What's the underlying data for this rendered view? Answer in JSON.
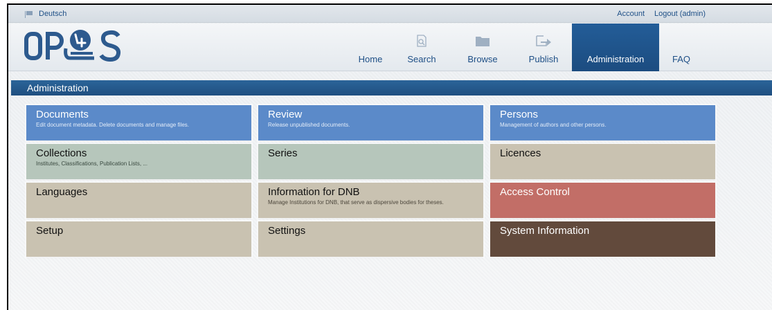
{
  "topbar": {
    "language_label": "Deutsch",
    "account_label": "Account",
    "logout_label": "Logout (admin)"
  },
  "logo": {
    "text": "OPUS",
    "brand_color": "#2d5a8e"
  },
  "nav": {
    "items": [
      {
        "label": "Home",
        "icon": null
      },
      {
        "label": "Search",
        "icon": "search-icon"
      },
      {
        "label": "Browse",
        "icon": "folder-icon"
      },
      {
        "label": "Publish",
        "icon": "publish-icon"
      },
      {
        "label": "Administration",
        "icon": null,
        "active": true
      },
      {
        "label": "FAQ",
        "icon": null
      }
    ]
  },
  "section": {
    "title": "Administration"
  },
  "tiles": [
    {
      "title": "Documents",
      "desc": "Edit document metadata. Delete documents and manage files.",
      "color": "blue"
    },
    {
      "title": "Review",
      "desc": "Release unpublished documents.",
      "color": "blue"
    },
    {
      "title": "Persons",
      "desc": "Management of authors and other persons.",
      "color": "blue"
    },
    {
      "title": "Collections",
      "desc": "Institutes, Classifications, Publication Lists, ...",
      "color": "green"
    },
    {
      "title": "Series",
      "desc": "",
      "color": "green"
    },
    {
      "title": "Licences",
      "desc": "",
      "color": "beige"
    },
    {
      "title": "Languages",
      "desc": "",
      "color": "beige"
    },
    {
      "title": "Information for DNB",
      "desc": "Manage Institutions for DNB, that serve as dispersive bodies for theses.",
      "color": "beige"
    },
    {
      "title": "Access Control",
      "desc": "",
      "color": "red"
    },
    {
      "title": "Setup",
      "desc": "",
      "color": "beige"
    },
    {
      "title": "Settings",
      "desc": "",
      "color": "beige"
    },
    {
      "title": "System Information",
      "desc": "",
      "color": "brown"
    }
  ],
  "colors": {
    "primary": "#1e4f86",
    "tile_blue": "#5b8ac9",
    "tile_green": "#b6c6bb",
    "tile_beige": "#c9c2b1",
    "tile_red": "#c26e67",
    "tile_brown": "#624a3c"
  }
}
